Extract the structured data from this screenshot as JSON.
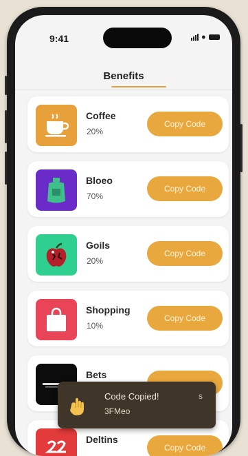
{
  "status_bar": {
    "time": "9:41"
  },
  "header": {
    "title": "Benefits"
  },
  "benefits": [
    {
      "name": "Coffee",
      "discount": "20%",
      "button_label": "Copy Code",
      "icon": "coffee-cup-icon",
      "color": "#e8a13a"
    },
    {
      "name": "Bloeo",
      "discount": "70%",
      "button_label": "Copy Code",
      "icon": "bag-icon",
      "color": "#6b2bc9"
    },
    {
      "name": "Goils",
      "discount": "20%",
      "button_label": "Copy Code",
      "icon": "apple-icon",
      "color": "#2fcf8f"
    },
    {
      "name": "Shopping",
      "discount": "10%",
      "button_label": "Copy Code",
      "icon": "shopping-bag-icon",
      "color": "#ea4458"
    },
    {
      "name": "Bets",
      "discount": "",
      "button_label": "",
      "icon": "dark-logo-icon",
      "color": "#0c0c0c"
    },
    {
      "name": "Deltins",
      "discount": "",
      "button_label": "Copy Code",
      "icon": "brand-logo-icon",
      "color": "#e33b3b"
    }
  ],
  "toast": {
    "title": "Code Copied!",
    "subtitle": "3FMeo",
    "close_symbol": "s",
    "icon": "hand-icon"
  }
}
